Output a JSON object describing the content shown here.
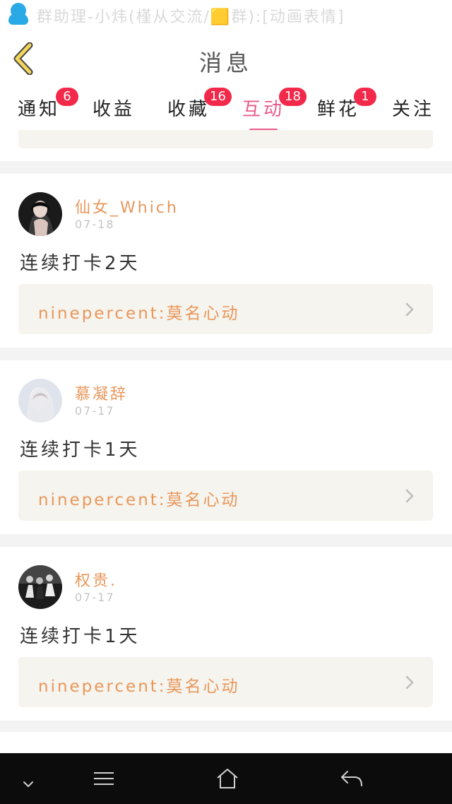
{
  "status_bar": {
    "notification_text": "群助理-小炜(槿从交流/🟨群):[动画表情]",
    "app_icon": "qq-penguin-icon"
  },
  "header": {
    "title": "消息",
    "back_icon": "chevron-left-icon"
  },
  "tabs": [
    {
      "label": "通知",
      "badge": "6",
      "active": false
    },
    {
      "label": "收益",
      "badge": "",
      "active": false
    },
    {
      "label": "收藏",
      "badge": "16",
      "active": false
    },
    {
      "label": "互动",
      "badge": "18",
      "active": true
    },
    {
      "label": "鲜花",
      "badge": "1",
      "active": false
    },
    {
      "label": "关注",
      "badge": "",
      "active": false
    }
  ],
  "feed": {
    "items": [
      {
        "user": "仙女_Which",
        "date": "07-18",
        "message": "连续打卡2天",
        "song": "ninepercent:莫名心动"
      },
      {
        "user": "慕凝辞",
        "date": "07-17",
        "message": "连续打卡1天",
        "song": "ninepercent:莫名心动"
      },
      {
        "user": "权贵.",
        "date": "07-17",
        "message": "连续打卡1天",
        "song": "ninepercent:莫名心动"
      }
    ]
  },
  "nav_bar": {
    "icons": [
      "chevron-down-icon",
      "menu-icon",
      "home-icon",
      "back-icon"
    ]
  },
  "colors": {
    "accent": "#ea5a8b",
    "badge": "#f2294a",
    "username": "#e9975b",
    "song_card": "#f5f4ee",
    "back_arrow": "#f2d65a"
  }
}
